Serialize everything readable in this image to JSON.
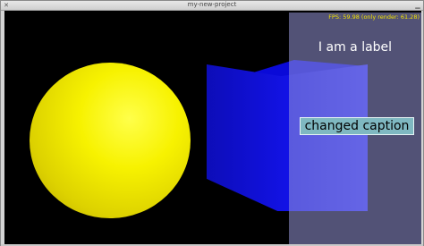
{
  "window": {
    "title": "my-new-project",
    "close_glyph": "✕",
    "minimize_glyph": "▁"
  },
  "viewport": {
    "fps_text": "FPS: 59.98 (only render: 61.28)",
    "label_text": "I am a label",
    "button_caption": "changed caption"
  },
  "colors": {
    "sphere": "#f7f200",
    "cube": "#1212e5",
    "overlay": "#9696d7",
    "button": "#7fb8c1",
    "fps_text": "#f3e300"
  },
  "scene_objects": [
    "yellow-sphere",
    "blue-cube"
  ]
}
